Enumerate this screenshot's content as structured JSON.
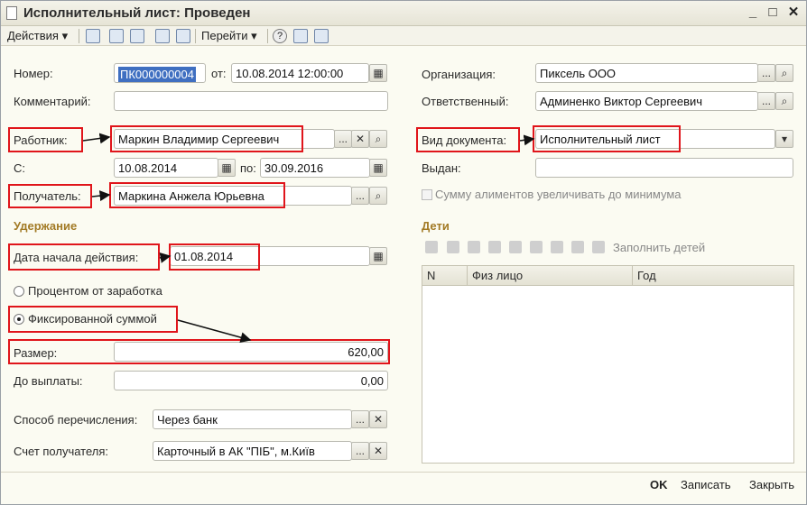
{
  "window": {
    "title": "Исполнительный лист: Проведен",
    "minimize_glyph": "_",
    "maximize_glyph": "□",
    "close_glyph": "✕"
  },
  "toolbar": {
    "actions_label": "Действия",
    "goto_label": "Перейти",
    "help_glyph": "?"
  },
  "left": {
    "number_label": "Номер:",
    "number_value": "ПК000000004",
    "from_label": "от:",
    "from_value": "10.08.2014 12:00:00",
    "comment_label": "Комментарий:",
    "comment_value": "",
    "employee_label": "Работник:",
    "employee_value": "Маркин Владимир Сергеевич",
    "period_from_label": "С:",
    "period_from_value": "10.08.2014",
    "period_to_label": "по:",
    "period_to_value": "30.09.2016",
    "recipient_label": "Получатель:",
    "recipient_value": "Маркина Анжела Юрьевна",
    "withholding_section": "Удержание",
    "start_date_label": "Дата начала действия:",
    "start_date_value": "01.08.2014",
    "percent_option": "Процентом от заработка",
    "fixed_option": "Фиксированной суммой",
    "amount_label": "Размер:",
    "amount_value": "620,00",
    "remaining_label": "До выплаты:",
    "remaining_value": "0,00",
    "transfer_method_label": "Способ перечисления:",
    "transfer_method_value": "Через банк",
    "account_label": "Счет получателя:",
    "account_value": "Карточный в АК \"ПІБ\", м.Київ"
  },
  "right": {
    "org_label": "Организация:",
    "org_value": "Пиксель ООО",
    "responsible_label": "Ответственный:",
    "responsible_value": "Админенко Виктор Сергеевич",
    "doc_type_label": "Вид документа:",
    "doc_type_value": "Исполнительный лист",
    "issued_label": "Выдан:",
    "issued_value": "",
    "min_alimony_label": "Сумму алиментов увеличивать до минимума",
    "children_section": "Дети",
    "fill_children_label": "Заполнить детей",
    "columns": [
      "N",
      "Физ лицо",
      "Год"
    ]
  },
  "buttons": {
    "select_glyph": "...",
    "clear_glyph": "✕",
    "dropdown_glyph": "▾"
  },
  "footer": {
    "ok": "OK",
    "save": "Записать",
    "close": "Закрыть"
  },
  "colors": {
    "highlight": "#e0151b",
    "section": "#a27a25",
    "selection": "#3f6fc1"
  }
}
